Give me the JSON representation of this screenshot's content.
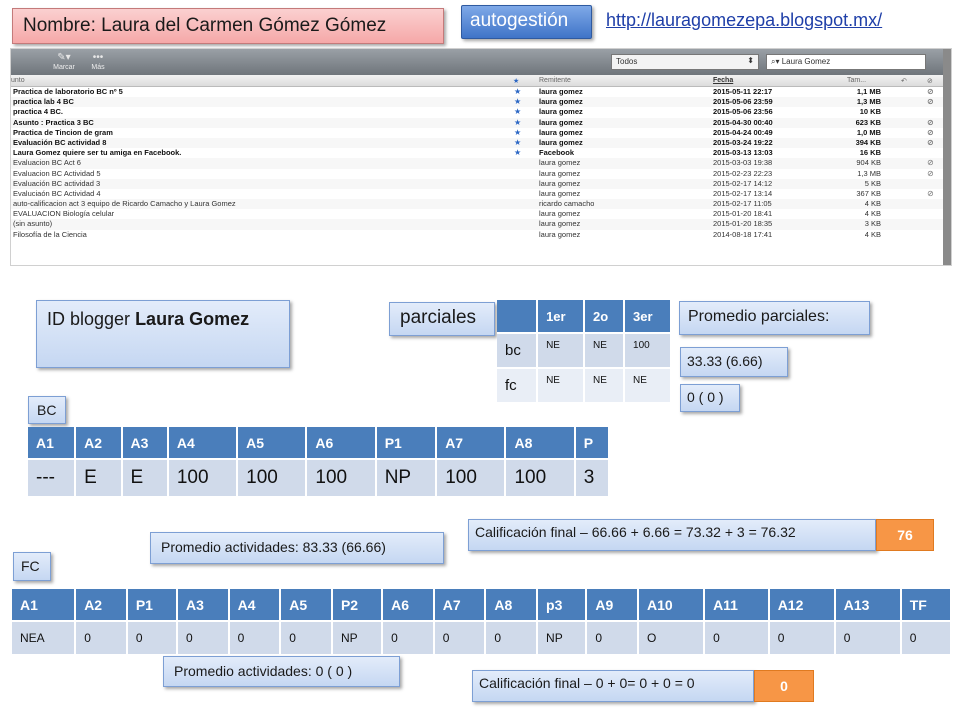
{
  "header": {
    "name_label": "Nombre: Laura del Carmen Gómez Gómez",
    "autogestion": "autogestión",
    "blog_url": "http://lauragomezepa.blogspot.mx/"
  },
  "mail": {
    "toolbar": {
      "mark_label": "Marcar",
      "more_label": "Más",
      "filter_value": "Todos",
      "search_value": "Laura Gomez"
    },
    "columns": {
      "subject": "unto",
      "sender": "Remitente",
      "date": "Fecha",
      "size": "Tam..."
    },
    "rows": [
      {
        "subject": "Practica de laboratorio BC nº 5",
        "sender": "laura gomez",
        "date": "2015-05-11 22:17",
        "size": "1,1 MB",
        "bold": true,
        "star": true,
        "clip": true
      },
      {
        "subject": "practica lab 4 BC",
        "sender": "laura gomez",
        "date": "2015-05-06 23:59",
        "size": "1,3 MB",
        "bold": true,
        "star": true,
        "clip": true
      },
      {
        "subject": "practica 4 BC.",
        "sender": "laura gomez",
        "date": "2015-05-06 23:56",
        "size": "10 KB",
        "bold": true,
        "star": true,
        "clip": false
      },
      {
        "subject": "Asunto : Practica 3 BC",
        "sender": "laura gomez",
        "date": "2015-04-30 00:40",
        "size": "623 KB",
        "bold": true,
        "star": true,
        "clip": true
      },
      {
        "subject": "Practica de Tincion de gram",
        "sender": "laura gomez",
        "date": "2015-04-24 00:49",
        "size": "1,0 MB",
        "bold": true,
        "star": true,
        "clip": true
      },
      {
        "subject": "Evaluación BC actividad 8",
        "sender": "laura gomez",
        "date": "2015-03-24 19:22",
        "size": "394 KB",
        "bold": true,
        "star": true,
        "clip": true
      },
      {
        "subject": "Laura Gomez quiere ser tu amiga en Facebook.",
        "sender": "Facebook",
        "date": "2015-03-13 13:03",
        "size": "16 KB",
        "bold": true,
        "star": true,
        "clip": false
      },
      {
        "subject": "Evaluacion BC Act 6",
        "sender": "laura gomez",
        "date": "2015-03-03 19:38",
        "size": "904 KB",
        "bold": false,
        "star": false,
        "clip": true
      },
      {
        "subject": "Evaluacion BC Actividad 5",
        "sender": "laura gomez",
        "date": "2015-02-23 22:23",
        "size": "1,3 MB",
        "bold": false,
        "star": false,
        "clip": true
      },
      {
        "subject": "Evaluación BC actividad 3",
        "sender": "laura gomez",
        "date": "2015-02-17 14:12",
        "size": "5 KB",
        "bold": false,
        "star": false,
        "clip": false
      },
      {
        "subject": "Evaluciaón BC Actividad 4",
        "sender": "laura gomez",
        "date": "2015-02-17 13:14",
        "size": "367 KB",
        "bold": false,
        "star": false,
        "clip": true
      },
      {
        "subject": "auto-calificacion act 3 equipo de Ricardo Camacho y Laura Gomez",
        "sender": "ricardo camacho",
        "date": "2015-02-17 11:05",
        "size": "4 KB",
        "bold": false,
        "star": false,
        "clip": false
      },
      {
        "subject": "EVALUACION Biología celular",
        "sender": "laura gomez",
        "date": "2015-01-20 18:41",
        "size": "4 KB",
        "bold": false,
        "star": false,
        "clip": false
      },
      {
        "subject": "(sin asunto)",
        "sender": "laura gomez",
        "date": "2015-01-20 18:35",
        "size": "3 KB",
        "bold": false,
        "star": false,
        "clip": false
      },
      {
        "subject": "Filosofía de la Ciencia",
        "sender": "laura gomez",
        "date": "2014-08-18 17:41",
        "size": "4 KB",
        "bold": false,
        "star": false,
        "clip": false
      }
    ]
  },
  "blogger": {
    "prefix": "ID blogger ",
    "name": "Laura Gomez"
  },
  "parciales": {
    "label": "parciales",
    "headers": [
      "",
      "1er",
      "2o",
      "3er"
    ],
    "rows": [
      {
        "name": "bc",
        "values": [
          "NE",
          "NE",
          "100"
        ]
      },
      {
        "name": "fc",
        "values": [
          "NE",
          "NE",
          "NE"
        ]
      }
    ],
    "promedio_label": "Promedio parciales:",
    "promedio_bc": "33.33 (6.66)",
    "promedio_fc": "0 ( 0 )"
  },
  "bc": {
    "label": "BC",
    "headers": [
      "A1",
      "A2",
      "A3",
      "A4",
      "A5",
      "A6",
      "P1",
      "A7",
      "A8",
      "P"
    ],
    "values": [
      "---",
      "E",
      "E",
      "100",
      "100",
      "100",
      "NP",
      "100",
      "100",
      "3"
    ],
    "promedio": "Promedio actividades: 83.33 (66.66)",
    "calificacion": "Calificación final – 66.66 + 6.66 = 73.32 + 3 = 76.32",
    "final": "76"
  },
  "fc": {
    "label": "FC",
    "headers": [
      "A1",
      "A2",
      "P1",
      "A3",
      "A4",
      "A5",
      "P2",
      "A6",
      "A7",
      "A8",
      "p3",
      "A9",
      "A10",
      "A11",
      "A12",
      "A13",
      "TF"
    ],
    "values": [
      "NEA",
      "0",
      "0",
      "0",
      "0",
      "0",
      "NP",
      "0",
      "0",
      "0",
      "NP",
      "0",
      "O",
      "0",
      "0",
      "0",
      "0"
    ],
    "promedio": "Promedio actividades: 0 ( 0 )",
    "calificacion": "Calificación final – 0 + 0= 0 + 0 = 0",
    "final": "0"
  }
}
